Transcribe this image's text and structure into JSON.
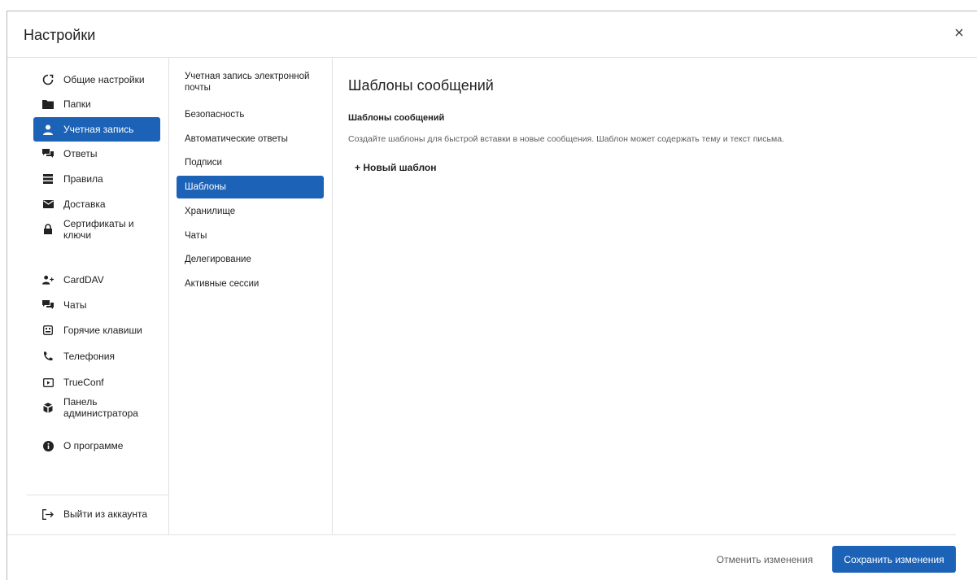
{
  "dialog": {
    "title": "Настройки",
    "close_icon": "close-icon"
  },
  "nav": {
    "items": [
      {
        "label": "Общие настройки",
        "icon": "settings-icon"
      },
      {
        "label": "Папки",
        "icon": "folder-icon"
      },
      {
        "label": "Учетная запись",
        "icon": "user-icon",
        "active": true
      },
      {
        "label": "Ответы",
        "icon": "chat-icon"
      },
      {
        "label": "Правила",
        "icon": "rules-icon"
      },
      {
        "label": "Доставка",
        "icon": "envelope-icon"
      },
      {
        "label": "Сертификаты и ключи",
        "icon": "lock-icon"
      },
      {
        "label": "CardDAV",
        "icon": "add-user-icon"
      },
      {
        "label": "Чаты",
        "icon": "chat-icon"
      },
      {
        "label": "Горячие клавиши",
        "icon": "keyboard-icon"
      },
      {
        "label": "Телефония",
        "icon": "phone-icon"
      },
      {
        "label": "TrueConf",
        "icon": "video-icon"
      },
      {
        "label": "Панель администратора",
        "icon": "admin-icon"
      },
      {
        "label": "О программе",
        "icon": "info-icon"
      }
    ],
    "logout": {
      "label": "Выйти из аккаунта",
      "icon": "logout-icon"
    }
  },
  "subnav": {
    "items": [
      {
        "label": "Учетная запись электронной почты"
      },
      {
        "label": "Безопасность"
      },
      {
        "label": "Автоматические ответы"
      },
      {
        "label": "Подписи"
      },
      {
        "label": "Шаблоны",
        "active": true
      },
      {
        "label": "Хранилище"
      },
      {
        "label": "Чаты"
      },
      {
        "label": "Делегирование"
      },
      {
        "label": "Активные сессии"
      }
    ]
  },
  "content": {
    "heading": "Шаблоны сообщений",
    "section_title": "Шаблоны сообщений",
    "description": "Создайте шаблоны для быстрой вставки в новые сообщения. Шаблон может содержать тему и текст письма.",
    "new_template": "+ Новый шаблон"
  },
  "footer": {
    "cancel_label": "Отменить изменения",
    "save_label": "Сохранить изменения"
  },
  "colors": {
    "accent": "#1c63b8",
    "border": "#e1e1e1",
    "muted_text": "#5e5e5e"
  }
}
